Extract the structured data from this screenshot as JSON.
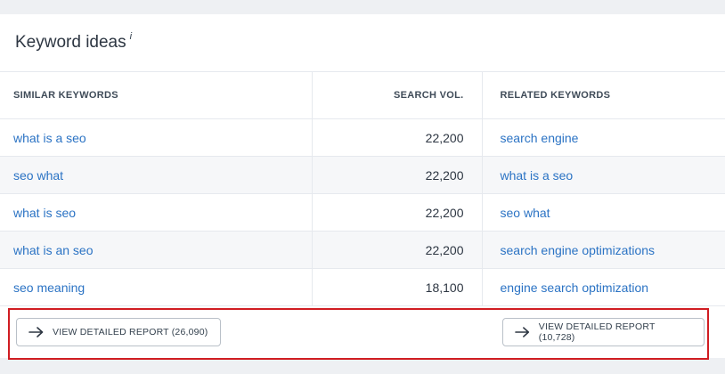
{
  "widget": {
    "title": "Keyword ideas",
    "info_glyph": "i"
  },
  "columns": {
    "similar": "SIMILAR KEYWORDS",
    "volume": "SEARCH VOL.",
    "related": "RELATED KEYWORDS"
  },
  "rows": [
    {
      "similar": "what is a seo",
      "volume": "22,200",
      "related": "search engine"
    },
    {
      "similar": "seo what",
      "volume": "22,200",
      "related": "what is a seo"
    },
    {
      "similar": "what is seo",
      "volume": "22,200",
      "related": "seo what"
    },
    {
      "similar": "what is an seo",
      "volume": "22,200",
      "related": "search engine optimizations"
    },
    {
      "similar": "seo meaning",
      "volume": "18,100",
      "related": "engine search optimization"
    }
  ],
  "footer": {
    "similar_report_label": "VIEW DETAILED REPORT (26,090)",
    "related_report_label": "VIEW DETAILED REPORT (10,728)"
  },
  "icons": {
    "report_arrow": "arrow-right-icon"
  },
  "colors": {
    "link": "#2b73c4",
    "highlight_border": "#d01d22"
  }
}
